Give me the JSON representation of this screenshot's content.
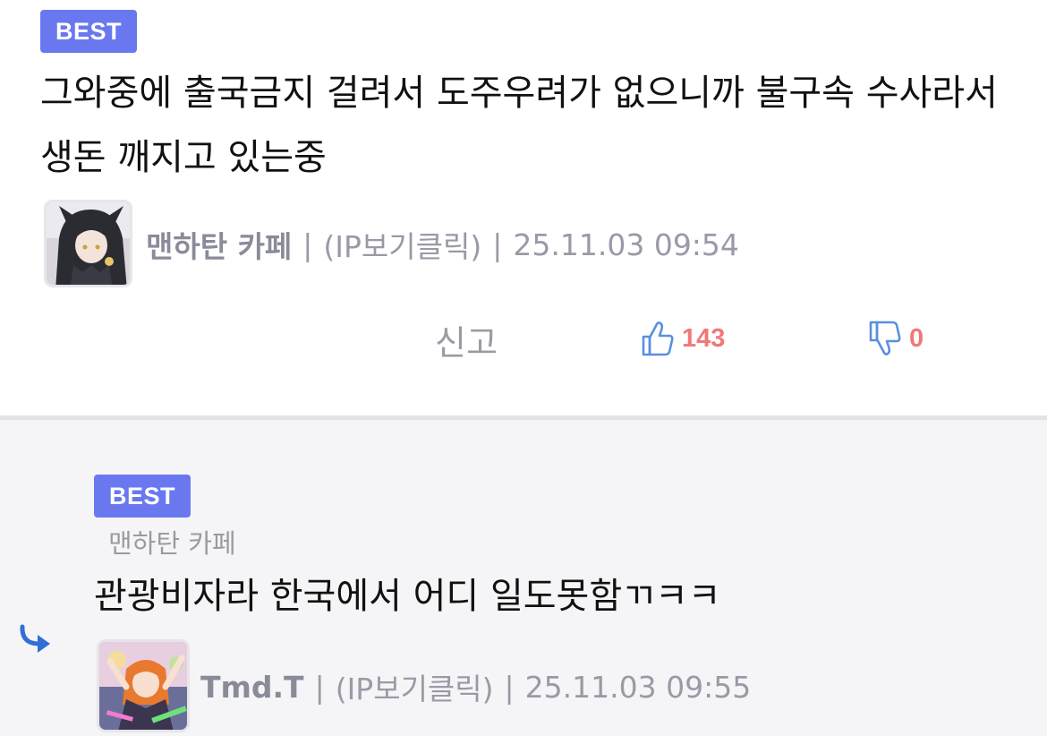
{
  "comment": {
    "badge": "BEST",
    "text": "그와중에 출국금지 걸려서 도주우려가 없으니까 불구속 수사라서 생돈 깨지고 있는중",
    "author": "맨하탄 카페",
    "ip_label": "(IP보기클릭)",
    "timestamp": "25.11.03 09:54",
    "separator": "|",
    "report_label": "신고",
    "upvotes": "143",
    "downvotes": "0"
  },
  "reply": {
    "badge": "BEST",
    "reply_to": "맨하탄 카페",
    "text": "관광비자라 한국에서 어디 일도못함ㄲㅋㅋ",
    "author": "Tmd.T",
    "ip_label": "(IP보기클릭)",
    "timestamp": "25.11.03 09:55",
    "separator": "|"
  },
  "colors": {
    "badge": "#6a78f0",
    "vote_count": "#f07878",
    "thumb_icon": "#5b8fe0",
    "reply_arrow": "#2f6fd6",
    "reply_background": "#f5f5f7"
  }
}
